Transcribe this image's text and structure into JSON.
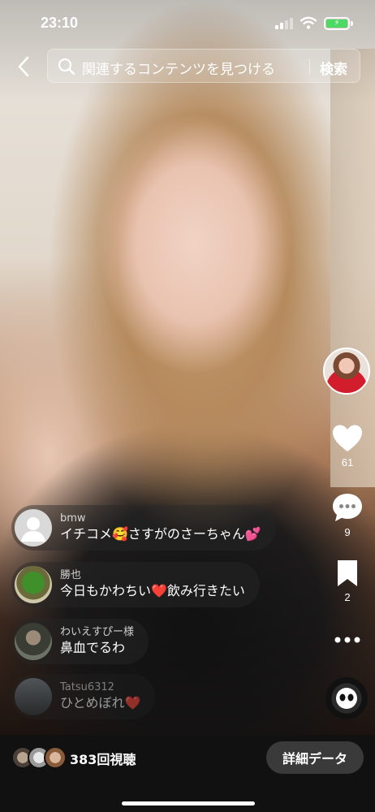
{
  "status_bar": {
    "time": "23:10",
    "battery_icon": "battery-charging-icon"
  },
  "search": {
    "back_icon": "chevron-left-icon",
    "placeholder": "関連するコンテンツを見つける",
    "button_label": "検索"
  },
  "rail": {
    "like_count": "61",
    "comment_count": "9",
    "bookmark_count": "2"
  },
  "comments": [
    {
      "user": "bmw",
      "text": "イチコメ🥰さすがのさーちゃん💕"
    },
    {
      "user": "勝也",
      "text": "今日もかわちい❤️飲み行きたい"
    },
    {
      "user": "わいえすぴー様",
      "text": "鼻血でるわ"
    },
    {
      "user": "Tatsu6312",
      "text": "ひとめぼれ❤️"
    }
  ],
  "bottom": {
    "views": "383回視聴",
    "details_button": "詳細データ"
  },
  "colors": {
    "battery": "#4cd964",
    "accent_red": "#d11d2c"
  }
}
